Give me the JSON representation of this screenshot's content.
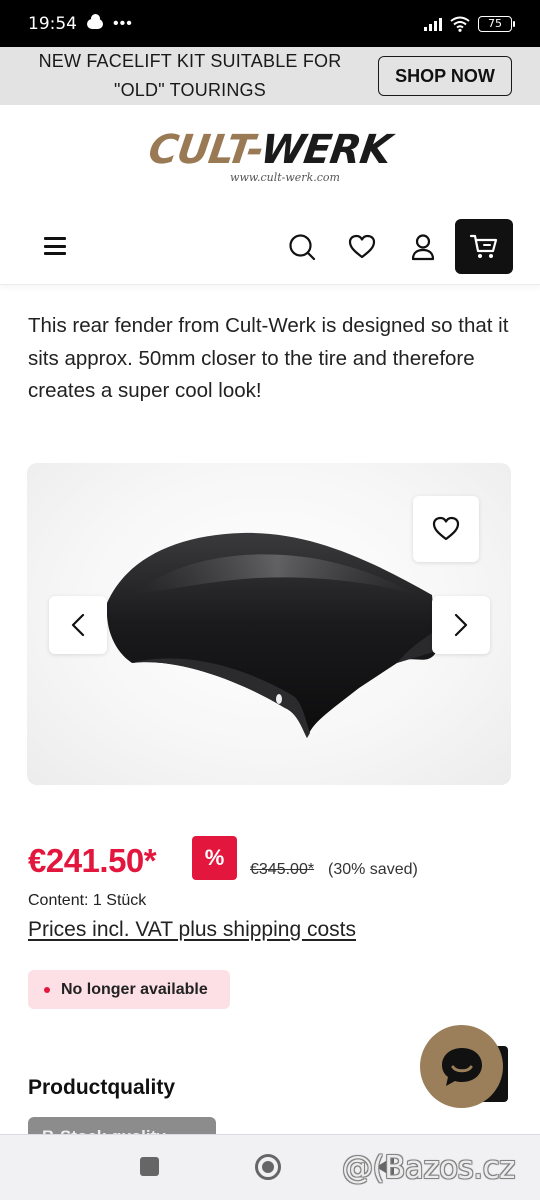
{
  "status_bar": {
    "time": "19:54",
    "more_indicator": "•••",
    "battery_level": "75",
    "icons": [
      "cloud-icon",
      "signal-icon",
      "wifi-icon",
      "battery-icon"
    ]
  },
  "promo": {
    "text": "NEW FACELIFT KIT SUITABLE FOR \"OLD\" TOURINGS",
    "button_label": "SHOP NOW"
  },
  "brand": {
    "logo_part1": "CULT-",
    "logo_part2": "WERK",
    "logo_url": "www.cult-werk.com",
    "colors": {
      "gold": "#9a7a55",
      "dark": "#1b1b1b"
    }
  },
  "nav": {
    "icons": [
      "menu-icon",
      "search-icon",
      "heart-icon",
      "user-icon",
      "cart-icon"
    ]
  },
  "product": {
    "description": "This rear fender from Cult-Werk is designed so that it sits approx. 50mm closer to the tire and therefore creates a super cool look!",
    "price": "€241.50*",
    "discount_badge": "%",
    "old_price": "€345.00*",
    "saved": "(30% saved)",
    "content": "Content: 1 Stück",
    "vat_link": "Prices incl. VAT plus shipping costs",
    "availability": "No longer available",
    "accent_color": "#e3173e"
  },
  "sections": {
    "quality_title": "Productquality",
    "quality_button": "B-Stock quality"
  },
  "watermark": "@(Bazos.cz"
}
